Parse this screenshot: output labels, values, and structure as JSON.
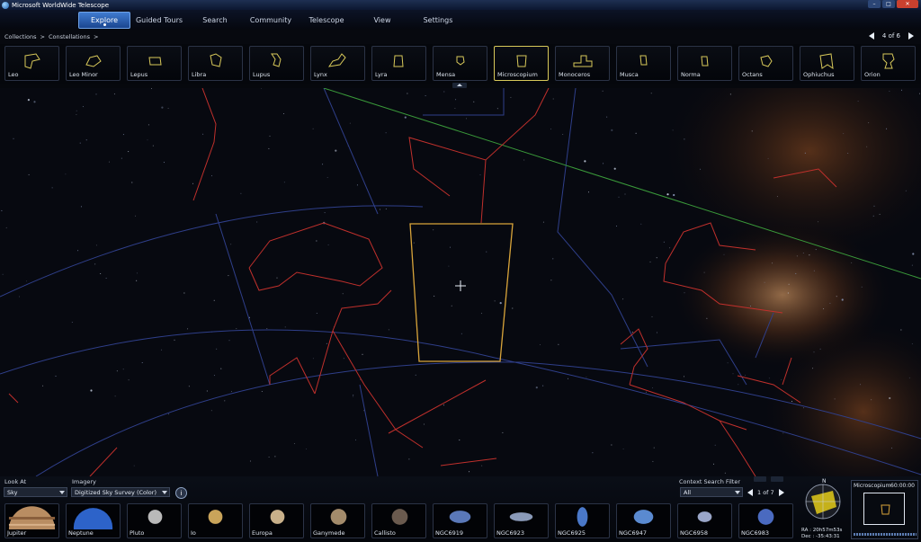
{
  "window": {
    "title": "Microsoft WorldWide Telescope"
  },
  "menu": {
    "items": [
      "Explore",
      "Guided Tours",
      "Search",
      "Community",
      "Telescope",
      "View",
      "Settings"
    ],
    "active": "Explore"
  },
  "breadcrumb": {
    "items": [
      "Collections",
      "Constellations"
    ],
    "separator": ">"
  },
  "pager": {
    "text": "4 of 6"
  },
  "constellations": [
    "Leo",
    "Leo Minor",
    "Lepus",
    "Libra",
    "Lupus",
    "Lynx",
    "Lyra",
    "Mensa",
    "Microscopium",
    "Monoceros",
    "Musca",
    "Norma",
    "Octans",
    "Ophiuchus",
    "Orion"
  ],
  "selected_constellation": "Microscopium",
  "bottom": {
    "look_at_label": "Look At",
    "look_at_value": "Sky",
    "imagery_label": "Imagery",
    "imagery_value": "Digitized Sky Survey (Color)",
    "context_filter_label": "Context Search Filter",
    "context_filter_value": "All",
    "context_pager": "1 of 7",
    "info_icon": "i"
  },
  "objects": [
    "Jupiter",
    "Neptune",
    "Pluto",
    "Io",
    "Europa",
    "Ganymede",
    "Callisto",
    "NGC6919",
    "NGC6923",
    "NGC6925",
    "NGC6947",
    "NGC6958",
    "NGC6983"
  ],
  "compass": {
    "north": "N",
    "ra": "RA : 20h57m53s",
    "dec": "Dec : -35:43:31"
  },
  "minimap": {
    "title": "Microscopium",
    "fov": "60:00:00"
  },
  "colors": {
    "accent": "#3f7bd0",
    "selection": "#d8c95a",
    "constellation_lines": "#c0302c",
    "boundaries": "#2f3f8a",
    "ecliptic": "#3a9a3a"
  }
}
